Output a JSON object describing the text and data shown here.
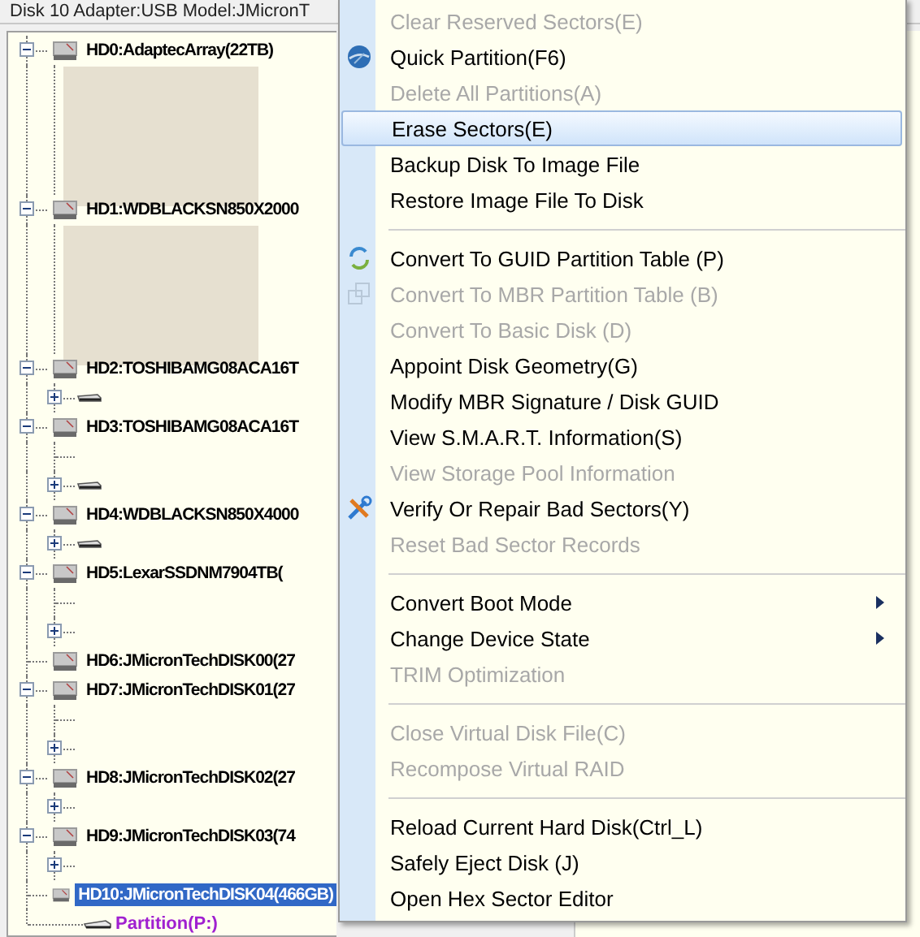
{
  "header": {
    "text": "Disk 10 Adapter:USB  Model:JMicronT"
  },
  "tree": [
    {
      "label": "HD0:AdaptecArray(22TB)",
      "expanded": true,
      "selected": false,
      "children": [
        {
          "kind": "redacted"
        }
      ]
    },
    {
      "label": "HD1:WDBLACKSN850X2000",
      "expanded": true,
      "selected": false,
      "children": [
        {
          "kind": "redacted"
        }
      ]
    },
    {
      "label": "HD2:TOSHIBAMG08ACA16T",
      "expanded": true,
      "selected": false,
      "children": [
        {
          "kind": "volume"
        }
      ]
    },
    {
      "label": "HD3:TOSHIBAMG08ACA16T",
      "expanded": true,
      "selected": false,
      "children": [
        {
          "kind": "stub"
        },
        {
          "kind": "volume"
        }
      ]
    },
    {
      "label": "HD4:WDBLACKSN850X4000",
      "expanded": true,
      "selected": false,
      "children": [
        {
          "kind": "volume"
        }
      ]
    },
    {
      "label": "HD5:LexarSSDNM7904TB(",
      "expanded": true,
      "selected": false,
      "children": [
        {
          "kind": "stub"
        },
        {
          "kind": "plus"
        }
      ]
    },
    {
      "label": "HD6:JMicronTechDISK00(27",
      "selected": false
    },
    {
      "label": "HD7:JMicronTechDISK01(27",
      "expanded": true,
      "selected": false,
      "children": [
        {
          "kind": "stub"
        },
        {
          "kind": "plus"
        }
      ]
    },
    {
      "label": "HD8:JMicronTechDISK02(27",
      "expanded": true,
      "selected": false,
      "children": [
        {
          "kind": "plus"
        }
      ]
    },
    {
      "label": "HD9:JMicronTechDISK03(74",
      "expanded": true,
      "selected": false,
      "children": [
        {
          "kind": "plus"
        }
      ]
    },
    {
      "label": "HD10:JMicronTechDISK04(466GB)",
      "selected": true,
      "children": [
        {
          "kind": "partition",
          "label": "Partition(P:)"
        }
      ]
    }
  ],
  "menu": [
    {
      "kind": "item",
      "label": "Clear Reserved Sectors(E)",
      "disabled": true,
      "selected": false
    },
    {
      "kind": "item",
      "label": "Quick Partition(F6)",
      "disabled": false,
      "selected": false
    },
    {
      "kind": "item",
      "label": "Delete All Partitions(A)",
      "disabled": true,
      "selected": false
    },
    {
      "kind": "item",
      "label": "Erase Sectors(E)",
      "disabled": false,
      "selected": true
    },
    {
      "kind": "item",
      "label": "Backup Disk To Image File",
      "disabled": false,
      "selected": false
    },
    {
      "kind": "item",
      "label": "Restore Image File To Disk",
      "disabled": false,
      "selected": false
    },
    {
      "kind": "separator"
    },
    {
      "kind": "item",
      "label": "Convert To GUID Partition Table (P)",
      "disabled": false,
      "selected": false
    },
    {
      "kind": "item",
      "label": "Convert To MBR Partition Table (B)",
      "disabled": true,
      "selected": false
    },
    {
      "kind": "item",
      "label": "Convert To Basic Disk (D)",
      "disabled": true,
      "selected": false
    },
    {
      "kind": "item",
      "label": "Appoint Disk Geometry(G)",
      "disabled": false,
      "selected": false
    },
    {
      "kind": "item",
      "label": "Modify MBR Signature / Disk GUID",
      "disabled": false,
      "selected": false
    },
    {
      "kind": "item",
      "label": "View S.M.A.R.T. Information(S)",
      "disabled": false,
      "selected": false
    },
    {
      "kind": "item",
      "label": "View Storage Pool Information",
      "disabled": true,
      "selected": false
    },
    {
      "kind": "item",
      "label": "Verify Or Repair Bad Sectors(Y)",
      "disabled": false,
      "selected": false
    },
    {
      "kind": "item",
      "label": "Reset Bad Sector Records",
      "disabled": true,
      "selected": false
    },
    {
      "kind": "separator"
    },
    {
      "kind": "item",
      "label": "Convert Boot Mode",
      "disabled": false,
      "selected": false,
      "submenu": true
    },
    {
      "kind": "item",
      "label": "Change Device State",
      "disabled": false,
      "selected": false,
      "submenu": true
    },
    {
      "kind": "item",
      "label": "TRIM Optimization",
      "disabled": true,
      "selected": false
    },
    {
      "kind": "separator"
    },
    {
      "kind": "item",
      "label": "Close Virtual Disk File(C)",
      "disabled": true,
      "selected": false
    },
    {
      "kind": "item",
      "label": "Recompose Virtual RAID",
      "disabled": true,
      "selected": false
    },
    {
      "kind": "separator"
    },
    {
      "kind": "item",
      "label": "Reload Current Hard Disk(Ctrl_L)",
      "disabled": false,
      "selected": false
    },
    {
      "kind": "item",
      "label": "Safely Eject Disk (J)",
      "disabled": false,
      "selected": false
    },
    {
      "kind": "item",
      "label": "Open Hex Sector Editor",
      "disabled": false,
      "selected": false
    }
  ]
}
